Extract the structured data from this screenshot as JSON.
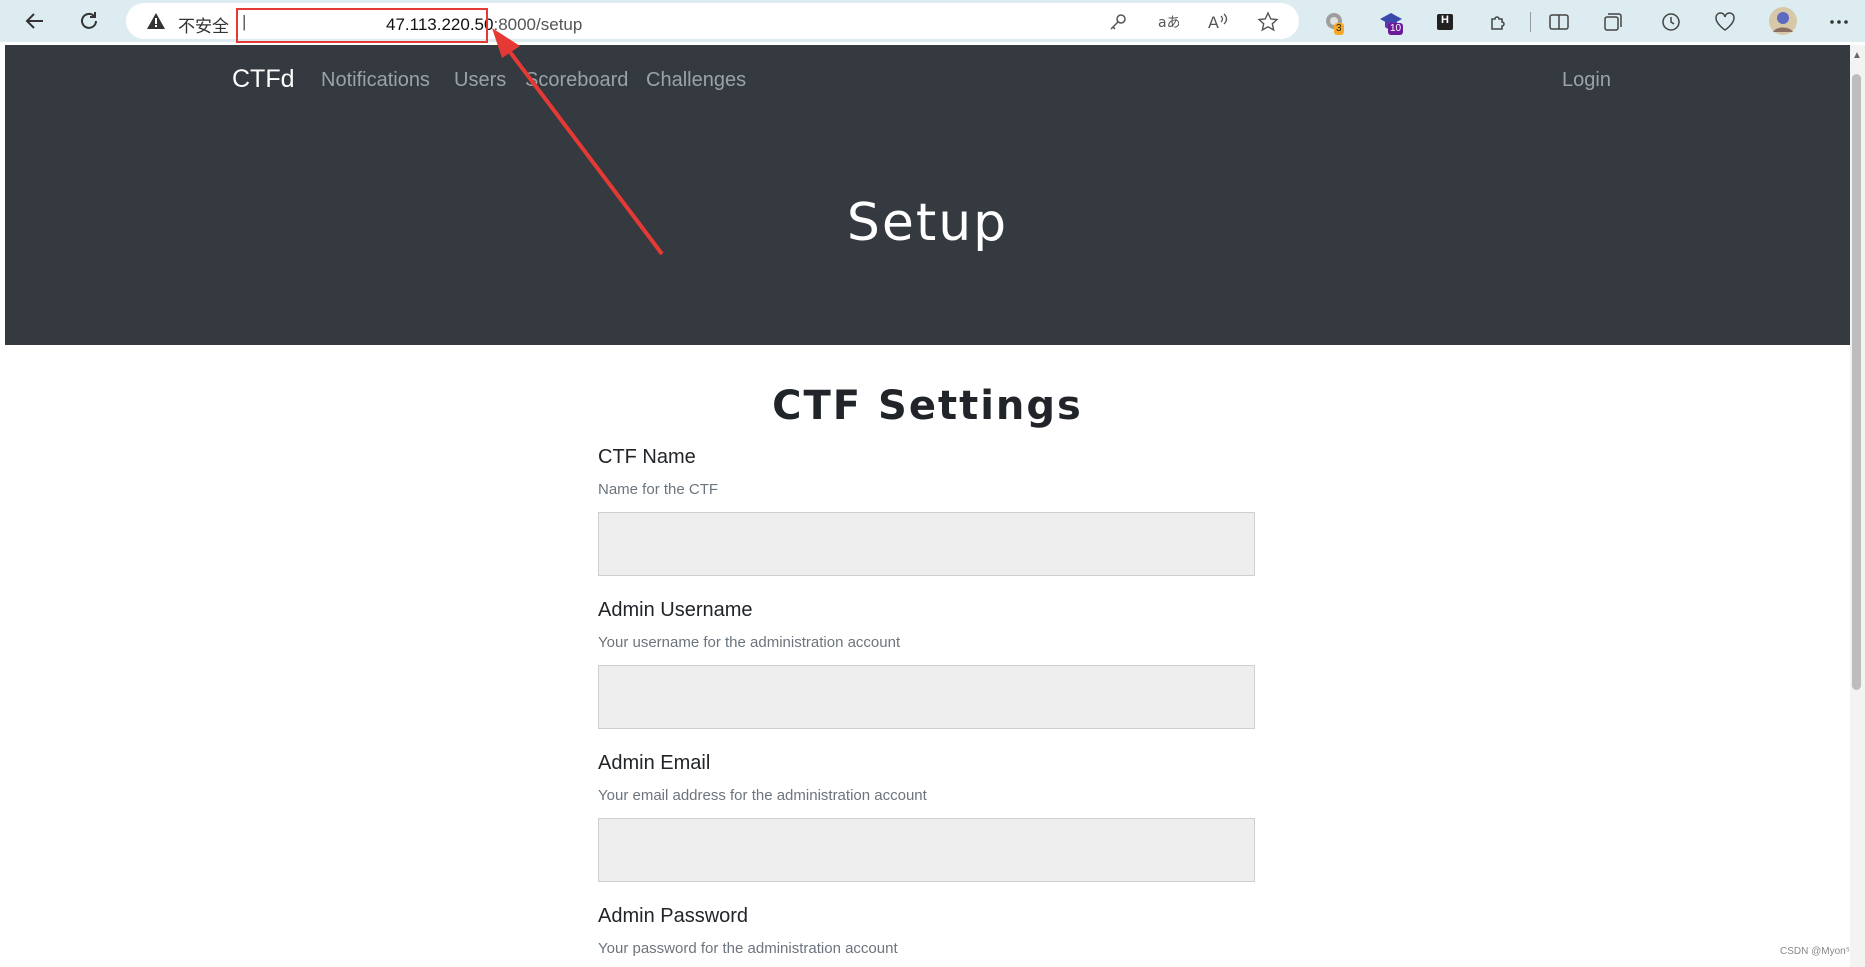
{
  "browser": {
    "insecure_label": "不安全",
    "separator": "|",
    "url_host": "47.113.220.50",
    "url_path": ":8000/setup",
    "badges": {
      "ext1": "3",
      "ext2": "10"
    },
    "ext3_letter": "H",
    "colors": {
      "highlight": "#e53935",
      "toolbar": "#dcecf0"
    }
  },
  "navbar": {
    "brand": "CTFd",
    "links": [
      "Notifications",
      "Users",
      "Scoreboard",
      "Challenges"
    ],
    "login": "Login"
  },
  "hero": {
    "title": "Setup"
  },
  "form": {
    "title": "CTF Settings",
    "fields": [
      {
        "label": "CTF Name",
        "help": "Name for the CTF",
        "value": ""
      },
      {
        "label": "Admin Username",
        "help": "Your username for the administration account",
        "value": ""
      },
      {
        "label": "Admin Email",
        "help": "Your email address for the administration account",
        "value": ""
      },
      {
        "label": "Admin Password",
        "help": "Your password for the administration account"
      }
    ]
  },
  "watermark": "CSDN @Myon⁵"
}
